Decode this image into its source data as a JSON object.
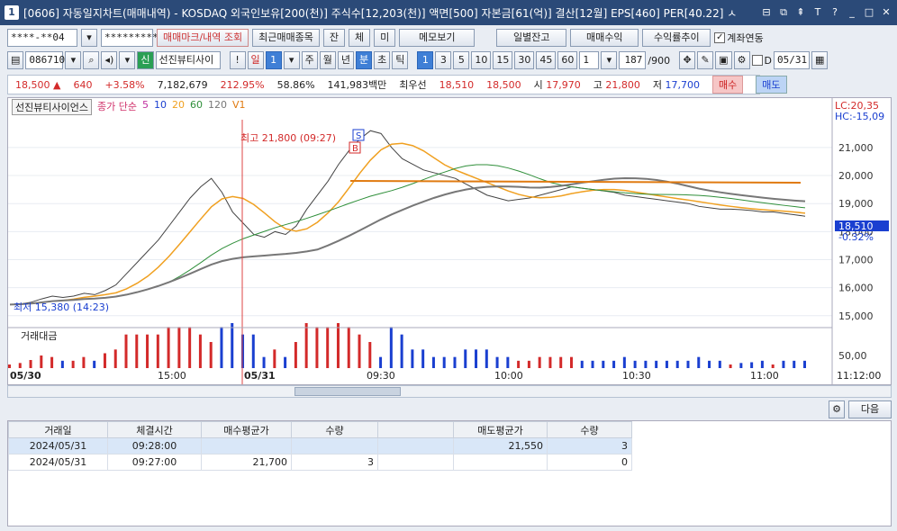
{
  "window": {
    "icon_label": "1",
    "title": "[0606] 자동일지차트(매매내역) - KOSDAQ 외국인보유[200(천)] 주식수[12,203(천)] 액면[500] 자본금[61(억)] 결산[12월] EPS[460] PER[40.22] ㅅ",
    "btn_labels": [
      "T",
      "?",
      "_",
      "□",
      "✕"
    ]
  },
  "toolbar1": {
    "account": "****-**04",
    "password": "*********",
    "buttons": [
      "매매마크/내역 조회",
      "최근매매종목",
      "잔",
      "체",
      "미",
      "메모보기",
      "일별잔고",
      "매매수익",
      "수익률추이"
    ],
    "checkbox_label": "계좌연동",
    "checkbox_checked": true
  },
  "toolbar2": {
    "code": "086710",
    "name_badge": "신",
    "stock_name": "선진뷰티사이",
    "period_buttons": [
      "!",
      "일",
      "1",
      "주",
      "월",
      "년",
      "분",
      "초",
      "틱",
      "1",
      "3",
      "5",
      "10",
      "15",
      "30",
      "45",
      "60",
      "1"
    ],
    "count": "187",
    "count_max": "/900",
    "date": "05/31",
    "d_label": "D"
  },
  "price": {
    "current": "18,500",
    "arrow": "▲",
    "change": "640",
    "pct": "+3.58%",
    "volume": "7,182,679",
    "vol_ratio": "212.95%",
    "turnover": "58.86%",
    "amount": "141,983백만",
    "best_ask_label": "최우선",
    "best_ask1": "18,510",
    "best_ask2": "18,500",
    "open_label": "시",
    "open": "17,970",
    "high_label": "고",
    "high": "21,800",
    "low_label": "저",
    "low": "17,700",
    "buy": "매수",
    "sell": "매도"
  },
  "chart_header": {
    "stock": "선진뷰티사이언스",
    "indicator": "종가 단순",
    "ma": [
      "5",
      "10",
      "20",
      "60",
      "120"
    ],
    "v1": "V1",
    "max_label": "최고 21,800 (09:27)",
    "min_label": "최저 15,380 (14:23)",
    "lc": "LC:20,35",
    "hc": "HC:-15,09",
    "cur_price": "18,510",
    "cur_pct": "-0.32%",
    "vol_title": "거래대금",
    "vol_tick": "50,00",
    "marker_s": "S",
    "marker_b": "B"
  },
  "chart_data": {
    "type": "line",
    "y_ticks": [
      "21,000",
      "20,000",
      "19,000",
      "18,000",
      "17,000",
      "16,000",
      "15,000"
    ],
    "ylim": [
      14800,
      21800
    ],
    "x_ticks": [
      "05/30",
      "15:00",
      "05/31",
      "09:30",
      "10:00",
      "10:30",
      "11:00",
      "11:12:00"
    ],
    "close": [
      15400,
      15420,
      15480,
      15600,
      15700,
      15650,
      15700,
      15800,
      15750,
      15900,
      16100,
      16500,
      16900,
      17300,
      17700,
      18200,
      18700,
      19200,
      19600,
      19900,
      19400,
      18700,
      18300,
      17900,
      17800,
      18000,
      17900,
      18200,
      18800,
      19300,
      19800,
      20400,
      20900,
      21300,
      21600,
      21500,
      21000,
      20600,
      20400,
      20200,
      20100,
      20000,
      19900,
      19700,
      19500,
      19300,
      19200,
      19100,
      19150,
      19200,
      19300,
      19400,
      19500,
      19600,
      19550,
      19500,
      19450,
      19400,
      19300,
      19250,
      19200,
      19150,
      19100,
      19050,
      19000,
      18900,
      18850,
      18800,
      18800,
      18780,
      18750,
      18700,
      18700,
      18650,
      18600,
      18550
    ]
  },
  "table": {
    "headers": [
      "거래일",
      "체결시간",
      "매수평균가",
      "수량",
      "",
      "매도평균가",
      "수량"
    ],
    "rows": [
      [
        "2024/05/31",
        "09:28:00",
        "",
        "",
        "",
        "21,550",
        "3"
      ],
      [
        "2024/05/31",
        "09:27:00",
        "21,700",
        "3",
        "",
        "",
        "0"
      ]
    ],
    "next_button": "다음"
  }
}
